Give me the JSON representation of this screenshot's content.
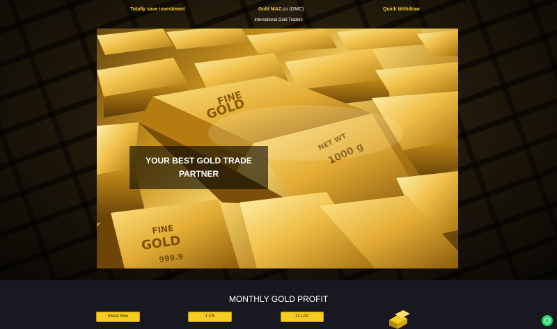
{
  "topbar": {
    "left": "Totally save investment",
    "center_brand": "Gold MAZ.",
    "center_suffix": "co (GMC)",
    "right": "Quick Withdraw",
    "subtitle": "International Gold Traders"
  },
  "hero": {
    "title": "YOUR BEST GOLD TRADE PARTNER",
    "bar_texts": {
      "fine": "FINE",
      "gold": "GOLD",
      "netwt": "NET WT",
      "weight": "1000 g",
      "purity": "999.9"
    }
  },
  "profit_section": {
    "title": "MONTHLY GOLD PROFIT",
    "invest_label": "Invest Now",
    "amount_1": "1 CR",
    "amount_2": "12 LAC"
  },
  "icons": {
    "gold_bars": "gold-bars-icon",
    "whatsapp": "whatsapp-icon"
  },
  "colors": {
    "accent_gold": "#f2c94c",
    "button_yellow": "#f4cd22",
    "section_bg": "#171820",
    "whatsapp_green": "#25d366"
  }
}
